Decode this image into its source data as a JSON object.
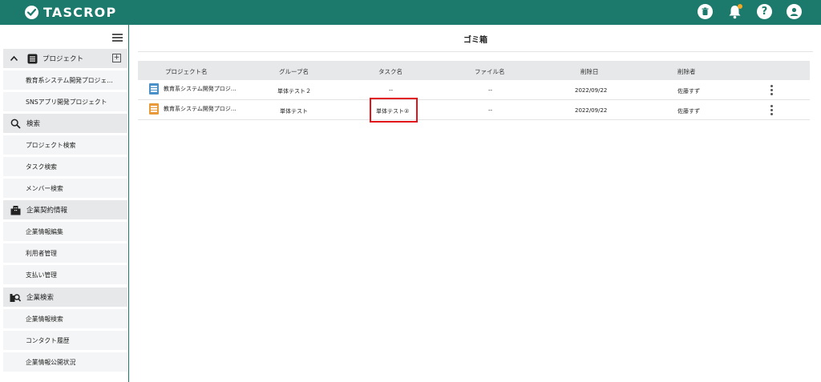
{
  "app": {
    "logo_text": "TASCROP"
  },
  "header_icons": [
    "trash-icon",
    "bell-icon",
    "help-icon",
    "user-icon"
  ],
  "help_glyph": "?",
  "sidebar": {
    "sections": [
      {
        "label": "プロジェクト",
        "icon": "list-icon",
        "items": [
          "教育系システム開発プロジェ…",
          "SNSアプリ開発プロジェクト"
        ]
      },
      {
        "label": "検索",
        "icon": "search-icon",
        "items": [
          "プロジェクト検索",
          "タスク検索",
          "メンバー検索"
        ]
      },
      {
        "label": "企業契約情報",
        "icon": "building-icon",
        "items": [
          "企業情報編集",
          "利用者管理",
          "支払い管理"
        ]
      },
      {
        "label": "企業検索",
        "icon": "company-search-icon",
        "items": [
          "企業情報検索",
          "コンタクト履歴",
          "企業情報公開状況"
        ]
      }
    ],
    "add_button": "+"
  },
  "main": {
    "title": "ゴミ箱",
    "columns": [
      "プロジェクト名",
      "グループ名",
      "タスク名",
      "ファイル名",
      "削除日",
      "削除者"
    ],
    "rows": [
      {
        "project": "教育系システム開発プロジ…",
        "group": "単体テスト２",
        "task": "--",
        "file": "--",
        "date": "2022/09/22",
        "user": "佐藤すず",
        "icon_color": "#4a90c8"
      },
      {
        "project": "教育系システム開発プロジ…",
        "group": "単体テスト",
        "task": "単体テスト②",
        "file": "--",
        "date": "2022/09/22",
        "user": "佐藤すず",
        "icon_color": "#e89a3a"
      }
    ]
  },
  "colors": {
    "brand": "#1b7a6c",
    "highlight": "#e0141a",
    "notification": "#f5a623"
  }
}
